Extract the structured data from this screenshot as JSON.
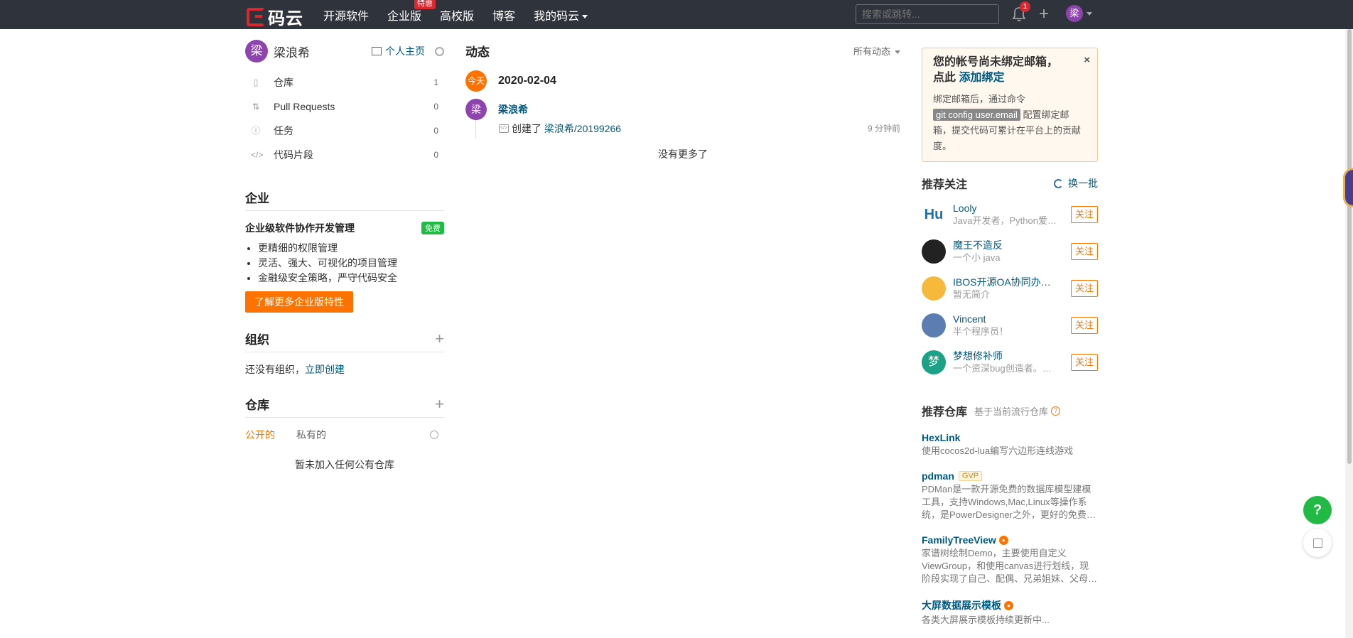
{
  "topbar": {
    "logo_text": "码云",
    "nav": [
      {
        "label": "开源软件"
      },
      {
        "label": "企业版",
        "badge": "特惠"
      },
      {
        "label": "高校版"
      },
      {
        "label": "博客"
      },
      {
        "label": "我的码云"
      }
    ],
    "search_placeholder": "搜索或跳转...",
    "notification_count": "1",
    "plus": "+",
    "avatar_char": "梁"
  },
  "left": {
    "avatar_char": "梁",
    "user_name": "梁浪希",
    "home_link": "个人主页",
    "menu": [
      {
        "icon": "repo-icon",
        "label": "仓库",
        "count": "1"
      },
      {
        "icon": "pull-request-icon",
        "label": "Pull Requests",
        "count": "0"
      },
      {
        "icon": "issue-icon",
        "label": "任务",
        "count": "0"
      },
      {
        "icon": "code-snippet-icon",
        "label": "代码片段",
        "count": "0"
      }
    ],
    "enterprise": {
      "title": "企业",
      "subtitle": "企业级软件协作开发管理",
      "badge": "免费",
      "features": [
        "更精细的权限管理",
        "灵活、强大、可视化的项目管理",
        "金融级安全策略，严守代码安全"
      ],
      "button": "了解更多企业版特性"
    },
    "org": {
      "title": "组织",
      "empty_text": "还没有组织，",
      "create_link": "立即创建"
    },
    "repos": {
      "title": "仓库",
      "tab_public": "公开的",
      "tab_private": "私有的",
      "empty": "暂未加入任何公有仓库"
    }
  },
  "feed": {
    "title": "动态",
    "filter": "所有动态",
    "today_label": "今天",
    "date": "2020-02-04",
    "avatar_char": "梁",
    "user": "梁浪希",
    "action": "创建了",
    "repo_link": "梁浪希/20199266",
    "time": "9 分钟前",
    "no_more": "没有更多了"
  },
  "right": {
    "notice": {
      "title_line1": "您的帐号尚未绑定邮箱，",
      "title_prefix": "点此 ",
      "title_link": "添加绑定",
      "close": "×",
      "body_before": "绑定邮箱后，通过命令",
      "command": "git config user.email",
      "body_after": "配置绑定邮箱，提交代码可累计在平台上的贡献度。"
    },
    "recommend_title": "推荐关注",
    "refresh": "换一批",
    "users": [
      {
        "avatar": "Hu",
        "color": "#ffffff",
        "text_color": "#1f6fb5",
        "name": "Looly",
        "desc": "Java开发者，Python爱好者",
        "follow": "关注"
      },
      {
        "avatar": "",
        "color": "#222222",
        "text_color": "#ffffff",
        "name": "魔王不造反",
        "desc": "一个小 java",
        "follow": "关注"
      },
      {
        "avatar": "",
        "color": "#f6b93b",
        "text_color": "#ffffff",
        "name": "IBOS开源OA协同办公平台",
        "desc": "暂无简介",
        "follow": "关注"
      },
      {
        "avatar": "",
        "color": "#5b7db1",
        "text_color": "#ffffff",
        "name": "Vincent",
        "desc": "半个程序员！",
        "follow": "关注"
      },
      {
        "avatar": "梦",
        "color": "#1aa186",
        "text_color": "#ffffff",
        "name": "梦想修补师",
        "desc": "一个资深bug创造者。一个热爱技术的人",
        "follow": "关注"
      }
    ],
    "repo_rec_title": "推荐仓库",
    "repo_rec_sub": "基于当前流行仓库",
    "repos": [
      {
        "name": "HexLink",
        "tag": "",
        "hot": false,
        "desc": "使用cocos2d-lua编写六边形连线游戏"
      },
      {
        "name": "pdman",
        "tag": "GVP",
        "hot": false,
        "desc": "PDMan是一款开源免费的数据库模型建模工具，支持Windows,Mac,Linux等操作系统，是PowerDesigner之外，更好的免费的替代方案"
      },
      {
        "name": "FamilyTreeView",
        "tag": "",
        "hot": true,
        "desc": "家谱树绘制Demo，主要使用自定义ViewGroup，和使用canvas进行划线，现阶段实现了自己、配偶、兄弟姐妹、父母等关系"
      },
      {
        "name": "大屏数据展示模板",
        "tag": "",
        "hot": true,
        "desc": "各类大屏展示模板持续更新中..."
      }
    ]
  },
  "floating": {
    "help": "?"
  }
}
